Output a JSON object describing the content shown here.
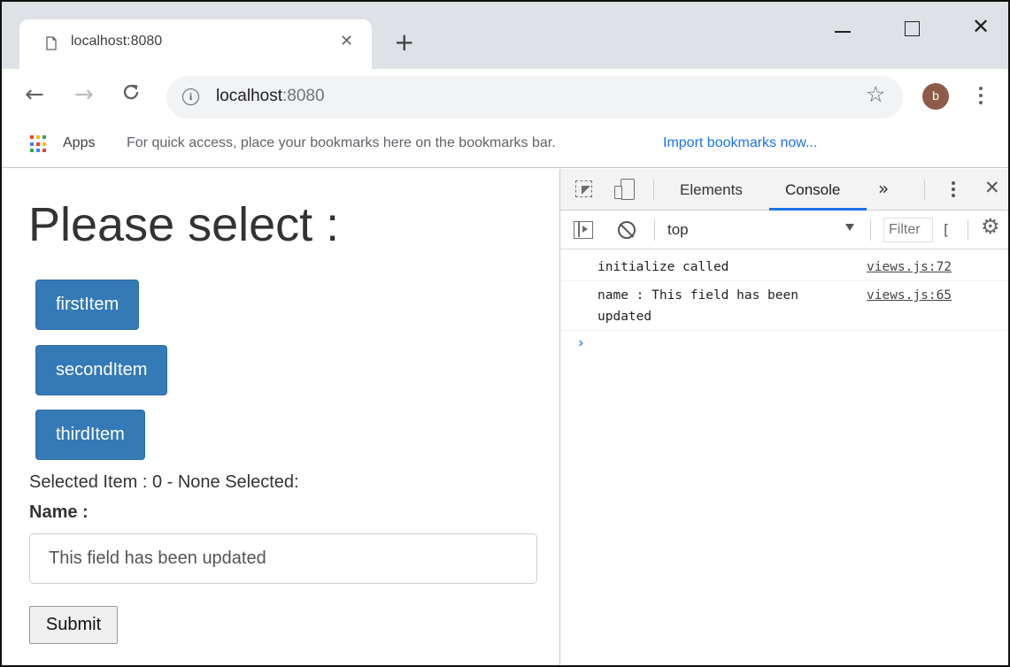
{
  "browser": {
    "tab": {
      "title": "localhost:8080",
      "close_glyph": "✕"
    },
    "new_tab_glyph": "+",
    "window": {
      "close_glyph": "✕"
    },
    "nav": {
      "back_glyph": "←",
      "forward_glyph": "→",
      "reload_glyph": "C"
    },
    "address": {
      "host": "localhost",
      "port": ":8080"
    },
    "star_glyph": "☆",
    "profile_initial": "b",
    "apps_colors": [
      "#ea4335",
      "#fbbc04",
      "#34a853",
      "#4285f4",
      "#ea4335",
      "#fbbc04",
      "#34a853",
      "#4285f4",
      "#ea4335"
    ],
    "bookmarks": {
      "apps_label": "Apps",
      "hint": "For quick access, place your bookmarks here on the bookmarks bar.",
      "import_link": "Import bookmarks now..."
    }
  },
  "page": {
    "title": "Please select :",
    "buttons": [
      {
        "label": "firstItem"
      },
      {
        "label": "secondItem"
      },
      {
        "label": "thirdItem"
      }
    ],
    "selected_text": "Selected Item : 0 - None Selected:",
    "name_label": "Name :",
    "name_value": "This field has been updated",
    "submit_label": "Submit",
    "accent_color": "#337ab7"
  },
  "devtools": {
    "tabs": {
      "elements": "Elements",
      "console": "Console",
      "more": "»"
    },
    "close_glyph": "✕",
    "context": "top",
    "filter_placeholder": "Filter",
    "levels_glyph": "[",
    "settings_glyph": "⚙",
    "logs": [
      {
        "message": "initialize called",
        "source": "views.js:72"
      },
      {
        "message": "name : This field has been updated",
        "source": "views.js:65"
      }
    ],
    "prompt_glyph": "›"
  }
}
